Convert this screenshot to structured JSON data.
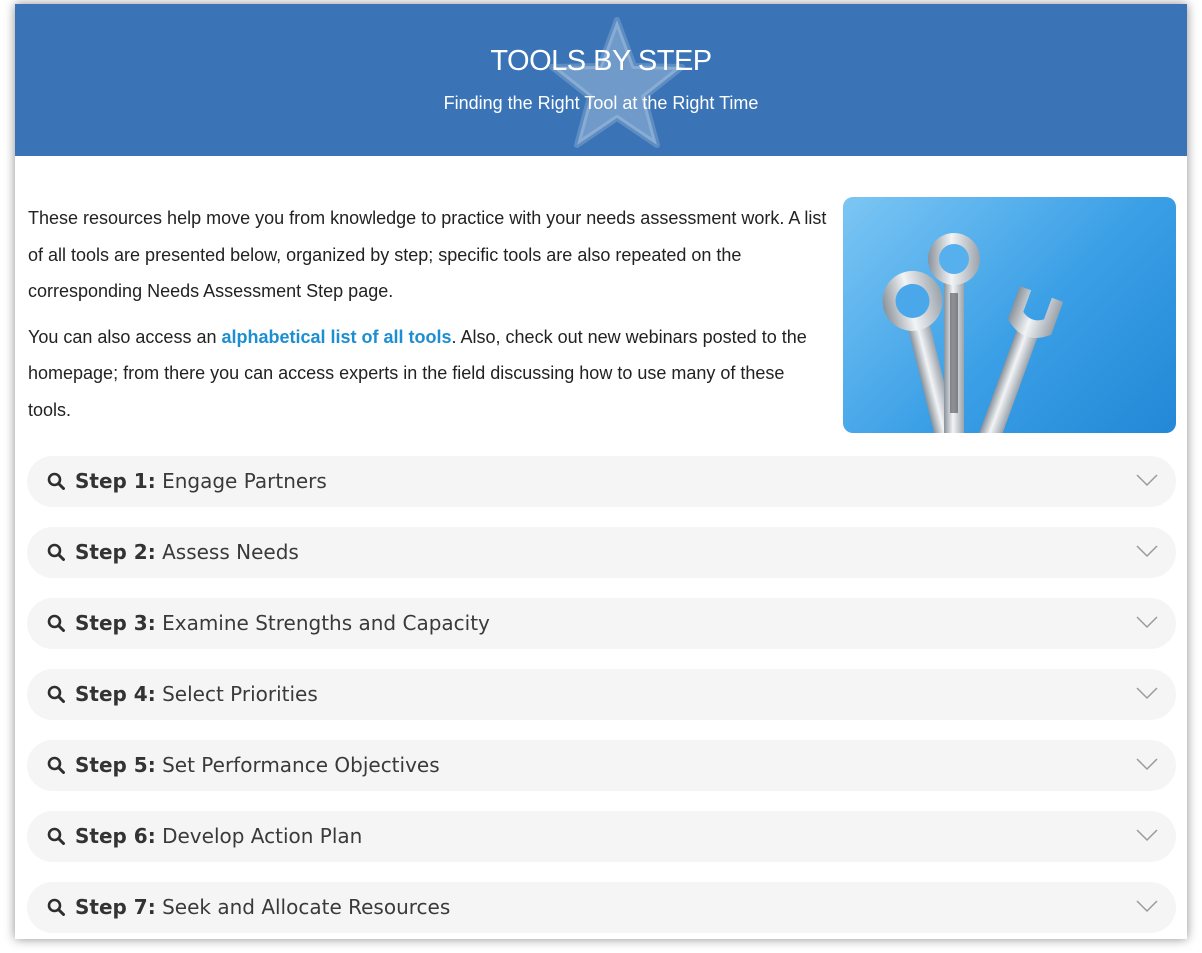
{
  "header": {
    "title": "TOOLS BY STEP",
    "subtitle": "Finding the Right Tool at the Right Time"
  },
  "intro": {
    "paragraph1": "These resources help move you from knowledge to practice with your needs assessment work. A list of all tools are presented below, organized by step; specific tools are also repeated on the corresponding Needs Assessment Step page.",
    "paragraph2_before": "You can also access an ",
    "paragraph2_link": "alphabetical list of all tools",
    "paragraph2_after": ". Also, check out new webinars posted to the homepage; from there you can access experts in the field discussing how to use many of these tools."
  },
  "steps": [
    {
      "num": "Step 1:",
      "title": "Engage Partners"
    },
    {
      "num": "Step 2:",
      "title": "Assess Needs"
    },
    {
      "num": "Step 3:",
      "title": "Examine Strengths and Capacity"
    },
    {
      "num": "Step 4:",
      "title": "Select Priorities"
    },
    {
      "num": "Step 5:",
      "title": "Set Performance Objectives"
    },
    {
      "num": "Step 6:",
      "title": "Develop Action Plan"
    },
    {
      "num": "Step 7:",
      "title": "Seek and Allocate Resources"
    }
  ],
  "colors": {
    "header_bg": "#3a74b6",
    "link": "#1c8fd3",
    "accordion_bg": "#f5f5f5"
  },
  "icons": {
    "header_decoration": "star-icon",
    "step_leading": "search-icon",
    "step_trailing": "chevron-down-icon"
  }
}
